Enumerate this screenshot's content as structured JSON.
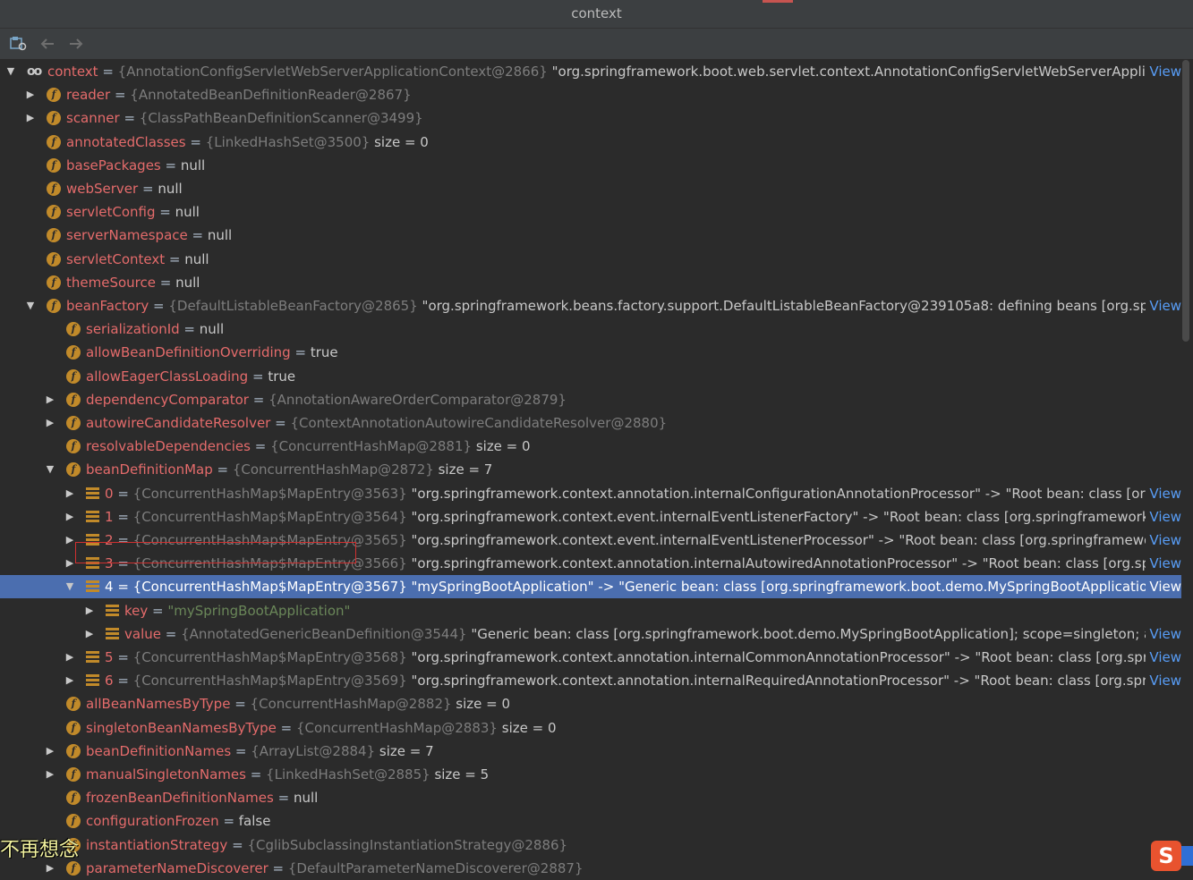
{
  "window": {
    "title": "context"
  },
  "toolbar": {
    "icons": [
      "watch-icon",
      "back-arrow-icon",
      "forward-arrow-icon"
    ]
  },
  "rows": [
    {
      "indent": 0,
      "arrow": "▼",
      "icon": "oo",
      "name": "context",
      "eq": " = ",
      "cls": "{AnnotationConfigServletWebServerApplicationContext@2866}",
      "val": " \"org.springframework.boot.web.servlet.context.AnnotationConfigServletWebServerApplicati...",
      "view": "View"
    },
    {
      "indent": 1,
      "arrow": "▶",
      "icon": "f",
      "name": "reader",
      "eq": " = ",
      "cls": "{AnnotatedBeanDefinitionReader@2867}",
      "val": "",
      "view": ""
    },
    {
      "indent": 1,
      "arrow": "▶",
      "icon": "f",
      "name": "scanner",
      "eq": " = ",
      "cls": "{ClassPathBeanDefinitionScanner@3499}",
      "val": "",
      "view": ""
    },
    {
      "indent": 1,
      "arrow": "",
      "icon": "f",
      "name": "annotatedClasses",
      "eq": " = ",
      "cls": "{LinkedHashSet@3500}",
      "val": "  size = 0",
      "view": ""
    },
    {
      "indent": 1,
      "arrow": "",
      "icon": "f",
      "name": "basePackages",
      "eq": " = ",
      "cls": "",
      "val": "null",
      "view": ""
    },
    {
      "indent": 1,
      "arrow": "",
      "icon": "f",
      "name": "webServer",
      "eq": " = ",
      "cls": "",
      "val": "null",
      "view": ""
    },
    {
      "indent": 1,
      "arrow": "",
      "icon": "f",
      "name": "servletConfig",
      "eq": " = ",
      "cls": "",
      "val": "null",
      "view": ""
    },
    {
      "indent": 1,
      "arrow": "",
      "icon": "f",
      "name": "serverNamespace",
      "eq": " = ",
      "cls": "",
      "val": "null",
      "view": ""
    },
    {
      "indent": 1,
      "arrow": "",
      "icon": "f",
      "name": "servletContext",
      "eq": " = ",
      "cls": "",
      "val": "null",
      "view": ""
    },
    {
      "indent": 1,
      "arrow": "",
      "icon": "f",
      "name": "themeSource",
      "eq": " = ",
      "cls": "",
      "val": "null",
      "view": ""
    },
    {
      "indent": 1,
      "arrow": "▼",
      "icon": "f",
      "name": "beanFactory",
      "eq": " = ",
      "cls": "{DefaultListableBeanFactory@2865}",
      "val": " \"org.springframework.beans.factory.support.DefaultListableBeanFactory@239105a8: defining beans [org.springfra...",
      "view": "View"
    },
    {
      "indent": 2,
      "arrow": "",
      "icon": "f",
      "name": "serializationId",
      "eq": " = ",
      "cls": "",
      "val": "null",
      "view": ""
    },
    {
      "indent": 2,
      "arrow": "",
      "icon": "f",
      "name": "allowBeanDefinitionOverriding",
      "eq": " = ",
      "cls": "",
      "val": "true",
      "view": ""
    },
    {
      "indent": 2,
      "arrow": "",
      "icon": "f",
      "name": "allowEagerClassLoading",
      "eq": " = ",
      "cls": "",
      "val": "true",
      "view": ""
    },
    {
      "indent": 2,
      "arrow": "▶",
      "icon": "f",
      "name": "dependencyComparator",
      "eq": " = ",
      "cls": "{AnnotationAwareOrderComparator@2879}",
      "val": "",
      "view": ""
    },
    {
      "indent": 2,
      "arrow": "▶",
      "icon": "f",
      "name": "autowireCandidateResolver",
      "eq": " = ",
      "cls": "{ContextAnnotationAutowireCandidateResolver@2880}",
      "val": "",
      "view": ""
    },
    {
      "indent": 2,
      "arrow": "",
      "icon": "f",
      "name": "resolvableDependencies",
      "eq": " = ",
      "cls": "{ConcurrentHashMap@2881}",
      "val": "  size = 0",
      "view": ""
    },
    {
      "indent": 2,
      "arrow": "▼",
      "icon": "f",
      "name": "beanDefinitionMap",
      "eq": " = ",
      "cls": "{ConcurrentHashMap@2872}",
      "val": "  size = 7",
      "view": ""
    },
    {
      "indent": 3,
      "arrow": "▶",
      "icon": "e",
      "name": "0",
      "eq": " = ",
      "cls": "{ConcurrentHashMap$MapEntry@3563}",
      "val": " \"org.springframework.context.annotation.internalConfigurationAnnotationProcessor\" -> \"Root bean: class [org.spri...",
      "view": "View"
    },
    {
      "indent": 3,
      "arrow": "▶",
      "icon": "e",
      "name": "1",
      "eq": " = ",
      "cls": "{ConcurrentHashMap$MapEntry@3564}",
      "val": " \"org.springframework.context.event.internalEventListenerFactory\" -> \"Root bean: class [org.springframework.cont...",
      "view": "View"
    },
    {
      "indent": 3,
      "arrow": "▶",
      "icon": "e",
      "name": "2",
      "eq": " = ",
      "cls": "{ConcurrentHashMap$MapEntry@3565}",
      "val": " \"org.springframework.context.event.internalEventListenerProcessor\" -> \"Root bean: class [org.springframework.co...",
      "view": "View"
    },
    {
      "indent": 3,
      "arrow": "▶",
      "icon": "e",
      "name": "3",
      "eq": " = ",
      "cls": "{ConcurrentHashMap$MapEntry@3566}",
      "val": " \"org.springframework.context.annotation.internalAutowiredAnnotationProcessor\" -> \"Root bean: class [org.spring...",
      "view": "View"
    },
    {
      "indent": 3,
      "arrow": "▼",
      "icon": "e",
      "name": "4",
      "eq": " = ",
      "cls": "{ConcurrentHashMap$MapEntry@3567}",
      "val": " \"mySpringBootApplication\" -> \"Generic bean: class [org.springframework.boot.demo.MySpringBootApplication]; s...",
      "view": "View",
      "selected": true
    },
    {
      "indent": 4,
      "arrow": "▶",
      "icon": "e",
      "name": "key",
      "eq": " = ",
      "cls": "",
      "val": "",
      "strg": "\"mySpringBootApplication\"",
      "view": ""
    },
    {
      "indent": 4,
      "arrow": "▶",
      "icon": "e",
      "name": "value",
      "eq": " = ",
      "cls": "{AnnotatedGenericBeanDefinition@3544}",
      "val": " \"Generic bean: class [org.springframework.boot.demo.MySpringBootApplication]; scope=singleton; abstr...",
      "view": "View"
    },
    {
      "indent": 3,
      "arrow": "▶",
      "icon": "e",
      "name": "5",
      "eq": " = ",
      "cls": "{ConcurrentHashMap$MapEntry@3568}",
      "val": " \"org.springframework.context.annotation.internalCommonAnnotationProcessor\" -> \"Root bean: class [org.springfi...",
      "view": "View"
    },
    {
      "indent": 3,
      "arrow": "▶",
      "icon": "e",
      "name": "6",
      "eq": " = ",
      "cls": "{ConcurrentHashMap$MapEntry@3569}",
      "val": " \"org.springframework.context.annotation.internalRequiredAnnotationProcessor\" -> \"Root bean: class [org.springfi...",
      "view": "View"
    },
    {
      "indent": 2,
      "arrow": "",
      "icon": "f",
      "name": "allBeanNamesByType",
      "eq": " = ",
      "cls": "{ConcurrentHashMap@2882}",
      "val": "  size = 0",
      "view": ""
    },
    {
      "indent": 2,
      "arrow": "",
      "icon": "f",
      "name": "singletonBeanNamesByType",
      "eq": " = ",
      "cls": "{ConcurrentHashMap@2883}",
      "val": "  size = 0",
      "view": ""
    },
    {
      "indent": 2,
      "arrow": "▶",
      "icon": "f",
      "name": "beanDefinitionNames",
      "eq": " = ",
      "cls": "{ArrayList@2884}",
      "val": "  size = 7",
      "view": ""
    },
    {
      "indent": 2,
      "arrow": "▶",
      "icon": "f",
      "name": "manualSingletonNames",
      "eq": " = ",
      "cls": "{LinkedHashSet@2885}",
      "val": "  size = 5",
      "view": ""
    },
    {
      "indent": 2,
      "arrow": "",
      "icon": "f",
      "name": "frozenBeanDefinitionNames",
      "eq": " = ",
      "cls": "",
      "val": "null",
      "view": ""
    },
    {
      "indent": 2,
      "arrow": "",
      "icon": "f",
      "name": "configurationFrozen",
      "eq": " = ",
      "cls": "",
      "val": "false",
      "view": ""
    },
    {
      "indent": 2,
      "arrow": "",
      "icon": "f",
      "name": "instantiationStrategy",
      "eq": " = ",
      "cls": "{CglibSubclassingInstantiationStrategy@2886}",
      "val": "",
      "view": ""
    },
    {
      "indent": 2,
      "arrow": "▶",
      "icon": "f",
      "name": "parameterNameDiscoverer",
      "eq": " = ",
      "cls": "{DefaultParameterNameDiscoverer@2887}",
      "val": "",
      "view": ""
    }
  ],
  "overlay": {
    "caption": "不再想念",
    "logo": "S"
  },
  "colors": {
    "background": "#2b2b2b",
    "selection": "#4b6eaf",
    "field_name": "#e46b6b",
    "link": "#589df6",
    "string": "#6a8759"
  }
}
